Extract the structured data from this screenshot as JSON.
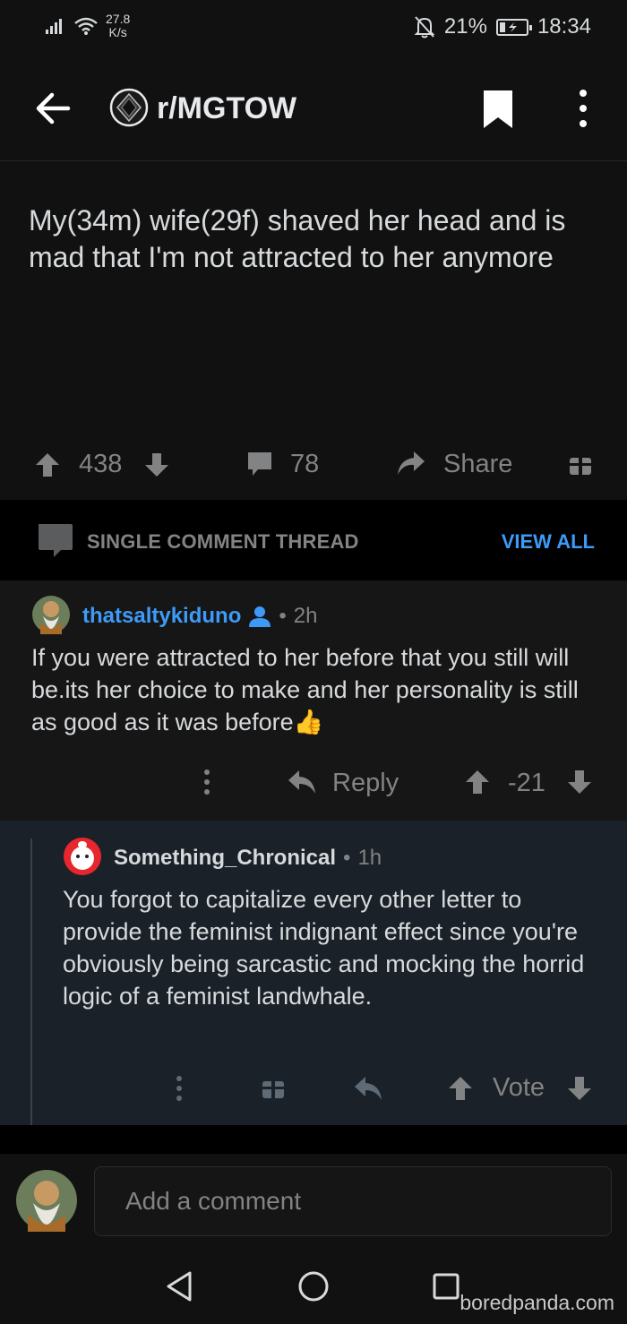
{
  "status_bar": {
    "network_speed_value": "27.8",
    "network_speed_unit": "K/s",
    "battery_percent": "21%",
    "time": "18:34",
    "icons": [
      "signal-icon",
      "wifi-icon",
      "mute-bell-icon",
      "battery-charging-icon"
    ]
  },
  "header": {
    "subreddit": "r/MGTOW",
    "icons": [
      "back-arrow-icon",
      "subreddit-icon",
      "bookmark-icon",
      "more-vertical-icon"
    ]
  },
  "post": {
    "title": "My(34m) wife(29f) shaved her head and is mad that I'm not attracted to her anymore",
    "score": "438",
    "comments": "78",
    "share_label": "Share"
  },
  "thread_bar": {
    "label": "SINGLE COMMENT THREAD",
    "view_all": "VIEW ALL"
  },
  "comments": [
    {
      "author": "thatsaltykiduno",
      "time": "2h",
      "body": "If you were attracted to her before that you still will be.its her choice to make and her personality is still as good as it was before",
      "emoji": "👍",
      "reply_label": "Reply",
      "score": "-21"
    },
    {
      "author": "Something_Chronical",
      "time": "1h",
      "body": "You forgot to capitalize every other letter to provide the feminist indignant effect since you're obviously being sarcastic and mocking the horrid logic of a feminist landwhale.",
      "vote_label": "Vote"
    }
  ],
  "composer": {
    "placeholder": "Add a comment"
  },
  "watermark": "boredpanda.com",
  "colors": {
    "background": "#111111",
    "accent_blue": "#3d9bf7",
    "muted": "#818384",
    "reply_bg": "#1b2128"
  }
}
